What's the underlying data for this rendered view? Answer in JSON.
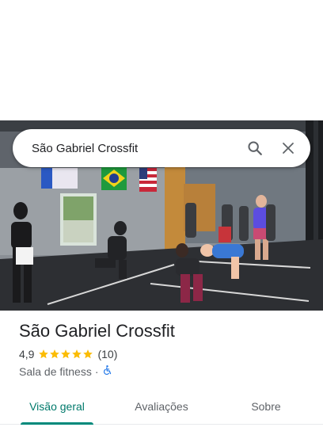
{
  "search": {
    "query": "São Gabriel Crossfit",
    "search_icon": "search-icon",
    "close_icon": "close-icon"
  },
  "place": {
    "title": "São Gabriel Crossfit",
    "rating": "4,9",
    "stars": 5,
    "reviews_count": "(10)",
    "category": "Sala de fitness",
    "separator": "·",
    "accessibility_icon": "wheelchair-icon"
  },
  "tabs": [
    {
      "label": "Visão geral",
      "active": true
    },
    {
      "label": "Avaliações",
      "active": false
    },
    {
      "label": "Sobre",
      "active": false
    }
  ],
  "colors": {
    "accent": "#00897b",
    "star": "#fbbc04",
    "accessibility": "#1a73e8"
  }
}
